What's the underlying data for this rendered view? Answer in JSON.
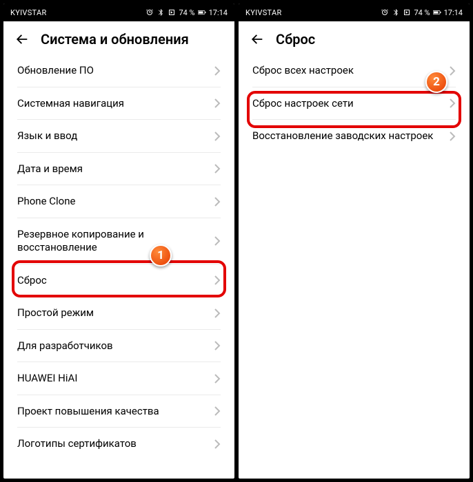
{
  "status": {
    "carrier": "KYIVSTAR",
    "battery_pct": "74 %",
    "time": "17:14"
  },
  "left": {
    "title": "Система и обновления",
    "items": [
      "Обновление ПО",
      "Системная навигация",
      "Язык и ввод",
      "Дата и время",
      "Phone Clone",
      "Резервное копирование и восстановление",
      "Сброс",
      "Простой режим",
      "Для разработчиков",
      "HUAWEI HiAI",
      "Проект повышения качества",
      "Логотипы сертификатов"
    ],
    "badge": "1"
  },
  "right": {
    "title": "Сброс",
    "items": [
      "Сброс всех настроек",
      "Сброс настроек сети",
      "Восстановление заводских настроек"
    ],
    "badge": "2"
  }
}
